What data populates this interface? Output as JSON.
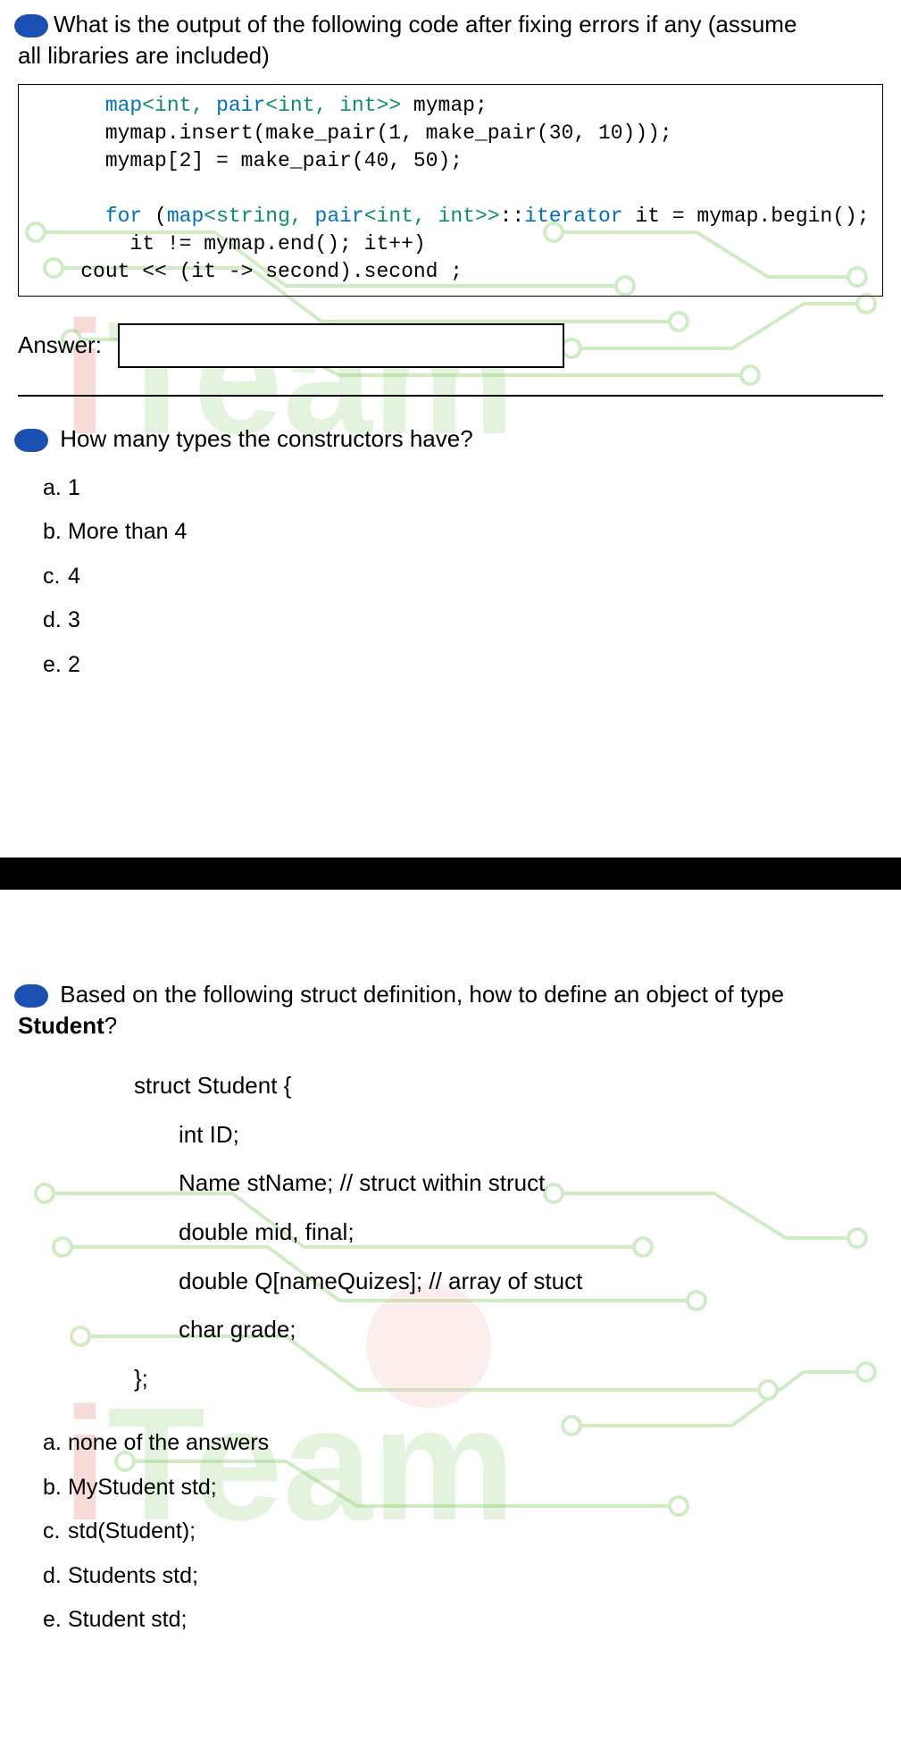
{
  "q1": {
    "prompt_a": "What is the output of the following code after fixing errors if any (assume",
    "prompt_b": "all libraries are included)",
    "code_l1_a": "map",
    "code_l1_b": "<int, ",
    "code_l1_c": "pair",
    "code_l1_d": "<int, int>>",
    "code_l1_e": " mymap;",
    "code_l2": "mymap.insert(make_pair(1, make_pair(30, 10)));",
    "code_l3": "mymap[2] = make_pair(40, 50);",
    "code_l4_a": "for",
    "code_l4_b": " (",
    "code_l4_c": "map",
    "code_l4_d": "<string, ",
    "code_l4_e": "pair",
    "code_l4_f": "<int, int>>",
    "code_l4_g": "::",
    "code_l4_h": "iterator",
    "code_l4_i": " it = mymap.begin();",
    "code_l5": "        it != mymap.end(); it++)",
    "code_l6": "    cout << (it -> second).second ;",
    "answer_label": "Answer:"
  },
  "q2": {
    "prompt": "How many types the constructors have?",
    "opts": {
      "a": "1",
      "b": "More than 4",
      "c": "4",
      "d": "3",
      "e": "2"
    }
  },
  "q3": {
    "prompt_a": "Based on the following struct definition, how to define an object of type ",
    "prompt_b": "Student",
    "prompt_c": "?",
    "struct": {
      "l1": "struct Student {",
      "l2": "int ID;",
      "l3": "Name stName;   // struct within struct",
      "l4": "double mid, final;",
      "l5": "double Q[nameQuizes];   // array of stuct",
      "l6": "char grade;",
      "l7": "};"
    },
    "opts": {
      "a": "none of the answers",
      "b": "MyStudent std;",
      "c": "std(Student);",
      "d": "Students std;",
      "e": "Student std;"
    }
  },
  "markers": {
    "a": "a.",
    "b": "b.",
    "c": "c.",
    "d": "d.",
    "e": "e."
  },
  "watermark": {
    "i": "i",
    "team": "Team"
  }
}
